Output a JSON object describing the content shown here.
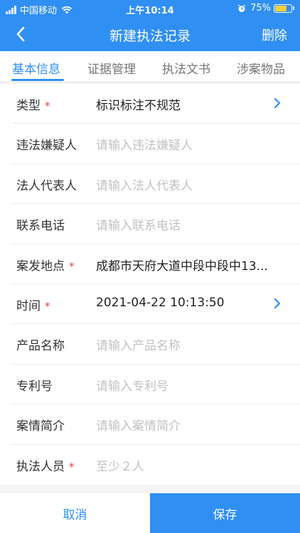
{
  "status_bar": {
    "carrier": "中国移动",
    "time": "上午10:14",
    "battery": "75%",
    "battery_level": 0.75
  },
  "nav": {
    "title": "新建执法记录",
    "right_action": "删除"
  },
  "tabs": [
    {
      "label": "基本信息",
      "active": true
    },
    {
      "label": "证据管理",
      "active": false
    },
    {
      "label": "执法文书",
      "active": false
    },
    {
      "label": "涉案物品",
      "active": false
    }
  ],
  "form": {
    "rows": [
      {
        "label": "类型",
        "required": true,
        "value": "标识标注不规范"
      },
      {
        "label": "违法嫌疑人",
        "required": false,
        "placeholder": "请输入违法嫌疑人"
      },
      {
        "label": "法人代表人",
        "required": false,
        "placeholder": "请输入法人代表人"
      },
      {
        "label": "联系电话",
        "required": false,
        "placeholder": "请输入联系电话"
      },
      {
        "label": "案发地点",
        "required": true,
        "value": "成都市天府大道中段中段中13..."
      },
      {
        "label": "时间",
        "required": true,
        "value": "2021-04-22 10:13:50"
      },
      {
        "label": "产品名称",
        "required": false,
        "placeholder": "请输入产品名称"
      },
      {
        "label": "专利号",
        "required": false,
        "placeholder": "请输入专利号"
      },
      {
        "label": "案情简介",
        "required": false,
        "placeholder": "请输入案情简介"
      },
      {
        "label": "执法人员",
        "required": true,
        "placeholder": "至少２人"
      }
    ],
    "required_mark": "*"
  },
  "footer": {
    "cancel": "取消",
    "save": "保存"
  },
  "colors": {
    "primary": "#2f8ff2",
    "required": "#e8413a",
    "placeholder": "#c2c2c2"
  }
}
